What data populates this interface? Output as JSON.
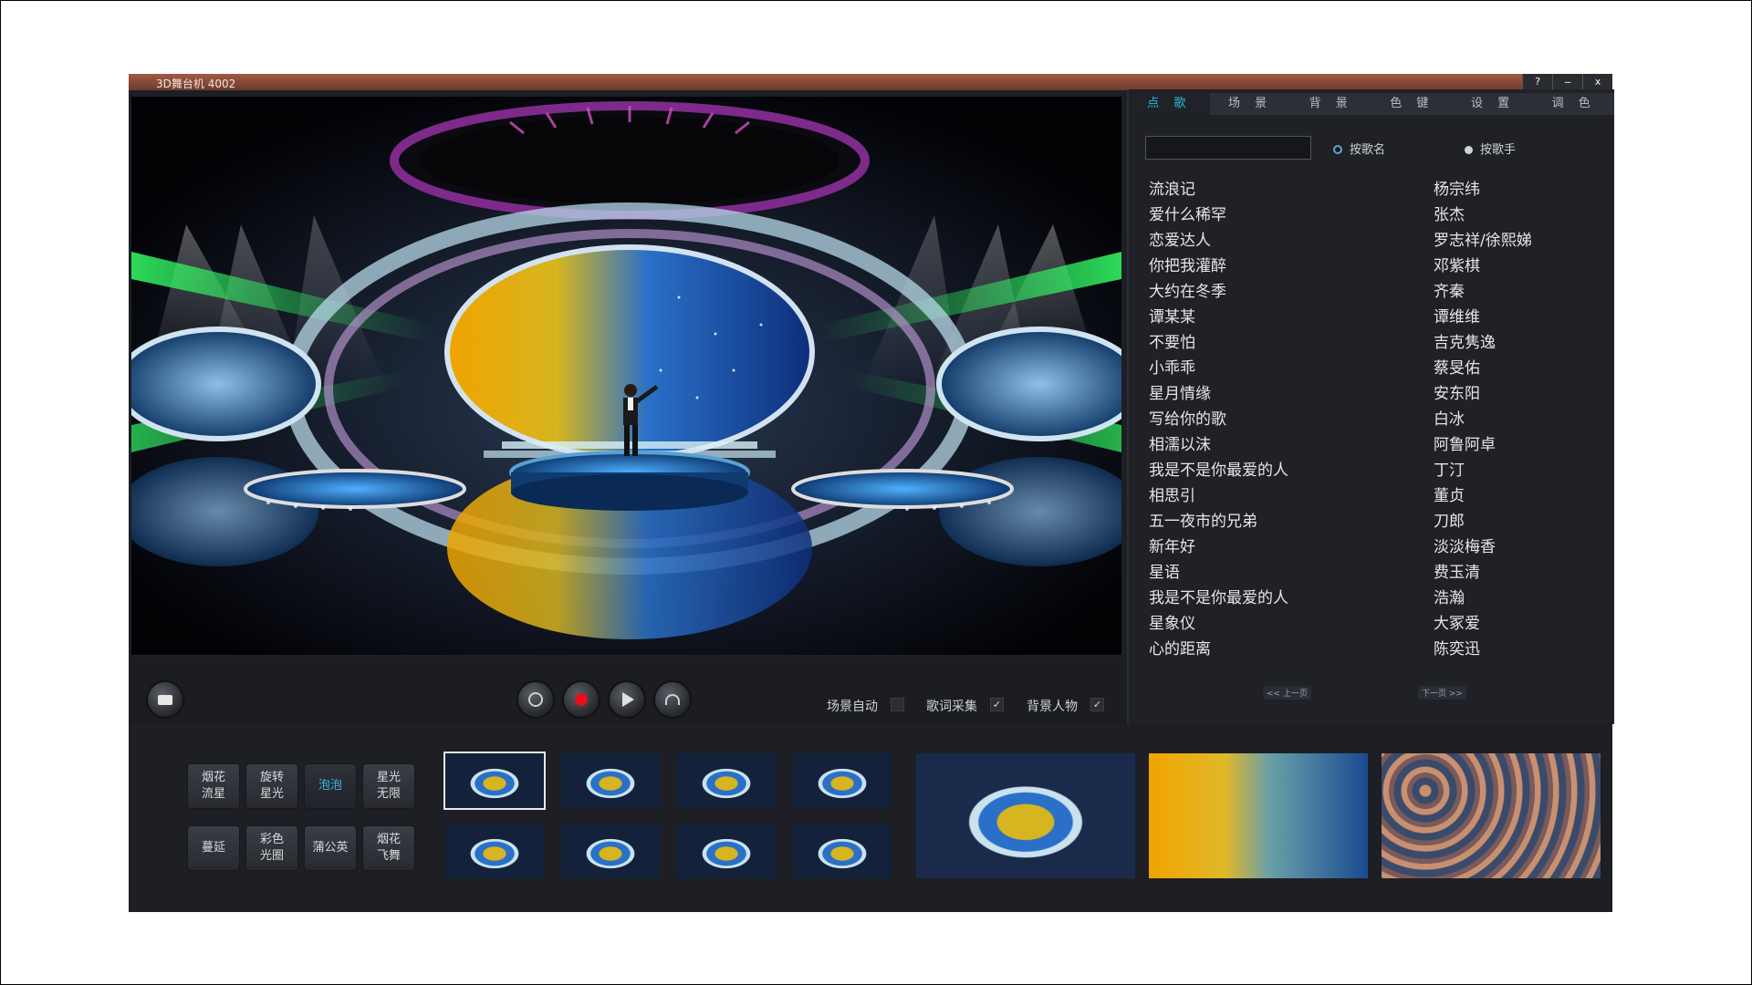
{
  "window": {
    "title": "3D舞台机  4002",
    "buttons": [
      "?",
      "–",
      "x"
    ]
  },
  "controls": {
    "buttons": [
      "folder-icon",
      "globe-icon",
      "record-icon",
      "play-icon",
      "headphones-icon"
    ],
    "checks": [
      {
        "label": "场景自动",
        "checked": false
      },
      {
        "label": "歌词采集",
        "checked": true
      },
      {
        "label": "背景人物",
        "checked": true
      }
    ],
    "checkmark": "✓"
  },
  "panel": {
    "tabs": [
      "点 歌",
      "场 景",
      "背 景",
      "色 键",
      "设 置",
      "调 色"
    ],
    "active_tab": 0,
    "search": {
      "value": "",
      "placeholder": ""
    },
    "radio_by_song": "按歌名",
    "radio_by_singer": "按歌手",
    "songs": [
      "流浪记",
      "爱什么稀罕",
      "恋爱达人",
      "你把我灌醉",
      "大约在冬季",
      "谭某某",
      "不要怕",
      "小乖乖",
      "星月情缘",
      "写给你的歌",
      "相濡以沫",
      "我是不是你最爱的人",
      "相思引",
      "五一夜市的兄弟",
      "新年好",
      "星语",
      "我是不是你最爱的人",
      "星象仪",
      "心的距离"
    ],
    "singers": [
      "杨宗纬",
      "张杰",
      "罗志祥/徐熙娣",
      "邓紫棋",
      "齐秦",
      "谭维维",
      "吉克隽逸",
      "蔡旻佑",
      "安东阳",
      "白冰",
      "阿鲁阿卓",
      "丁汀",
      "董贞",
      "刀郎",
      "淡淡梅香",
      "费玉清",
      "浩瀚",
      "大冢爱",
      "陈奕迅"
    ],
    "prev_page": "<< 上一页",
    "next_page": "下一页 >>"
  },
  "effects": [
    "烟花\n流星",
    "旋转\n星光",
    "泡泡",
    "星光\n无限",
    "蔓延",
    "彩色\n光圈",
    "蒲公英",
    "烟花\n飞舞"
  ],
  "active_effect": 2,
  "colors": {
    "accent": "#2fb8d8",
    "titlebar": "#8a4a38",
    "app_bg": "#1d1f25"
  }
}
